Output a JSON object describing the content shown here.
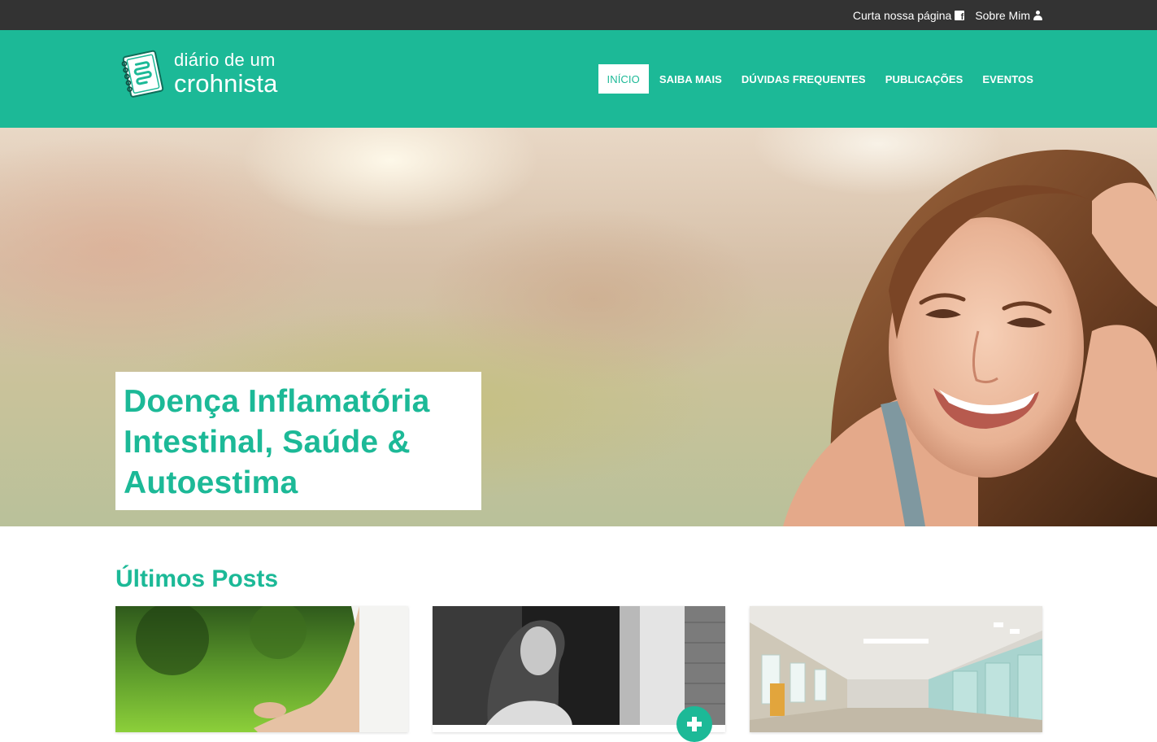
{
  "topbar": {
    "like_page_label": "Curta nossa página",
    "about_me_label": "Sobre Mim"
  },
  "logo": {
    "line1": "diário de um",
    "line2": "crohnista"
  },
  "nav": {
    "items": [
      {
        "label": "INÍCIO",
        "active": true
      },
      {
        "label": "SAIBA MAIS",
        "active": false
      },
      {
        "label": "DÚVIDAS FREQUENTES",
        "active": false
      },
      {
        "label": "PUBLICAÇÕES",
        "active": false
      },
      {
        "label": "EVENTOS",
        "active": false
      }
    ]
  },
  "hero": {
    "headline": "Doença Inflamatória Intestinal, Saúde & Autoestima"
  },
  "posts": {
    "section_title": "Últimos Posts"
  },
  "colors": {
    "brand": "#1cb997",
    "topbar": "#333333"
  },
  "icons": [
    "facebook-icon",
    "user-icon",
    "notebook-intestine-logo-icon",
    "plus-icon"
  ]
}
